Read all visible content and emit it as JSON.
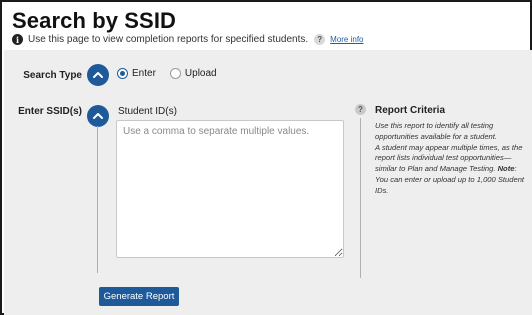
{
  "header": {
    "title": "Search by SSID",
    "intro_text": "Use this page to view completion reports for specified students.",
    "info_icon": "info-icon",
    "help_icon_glyph": "?",
    "more_info_link": "More info"
  },
  "search_type": {
    "label": "Search Type",
    "options": [
      {
        "label": "Enter",
        "selected": true
      },
      {
        "label": "Upload",
        "selected": false
      }
    ]
  },
  "ssid_section": {
    "label": "Enter SSID(s)",
    "field_label": "Student ID(s)",
    "placeholder": "Use a comma to separate multiple values.",
    "value": ""
  },
  "report_criteria": {
    "help_glyph": "?",
    "title": "Report Criteria",
    "text_1": "Use this report to identify all testing opportunities available for a student.",
    "text_2": "A student may appear multiple times, as the report lists individual test opportunities—similar to Plan and Manage Testing.",
    "note_label": "Note",
    "note_text": ": You can enter or upload up to 1,000 Student IDs."
  },
  "actions": {
    "generate_label": "Generate Report"
  },
  "colors": {
    "accent": "#1e5a9a",
    "panel_bg": "#eeeeee",
    "link": "#1f5fa8"
  }
}
